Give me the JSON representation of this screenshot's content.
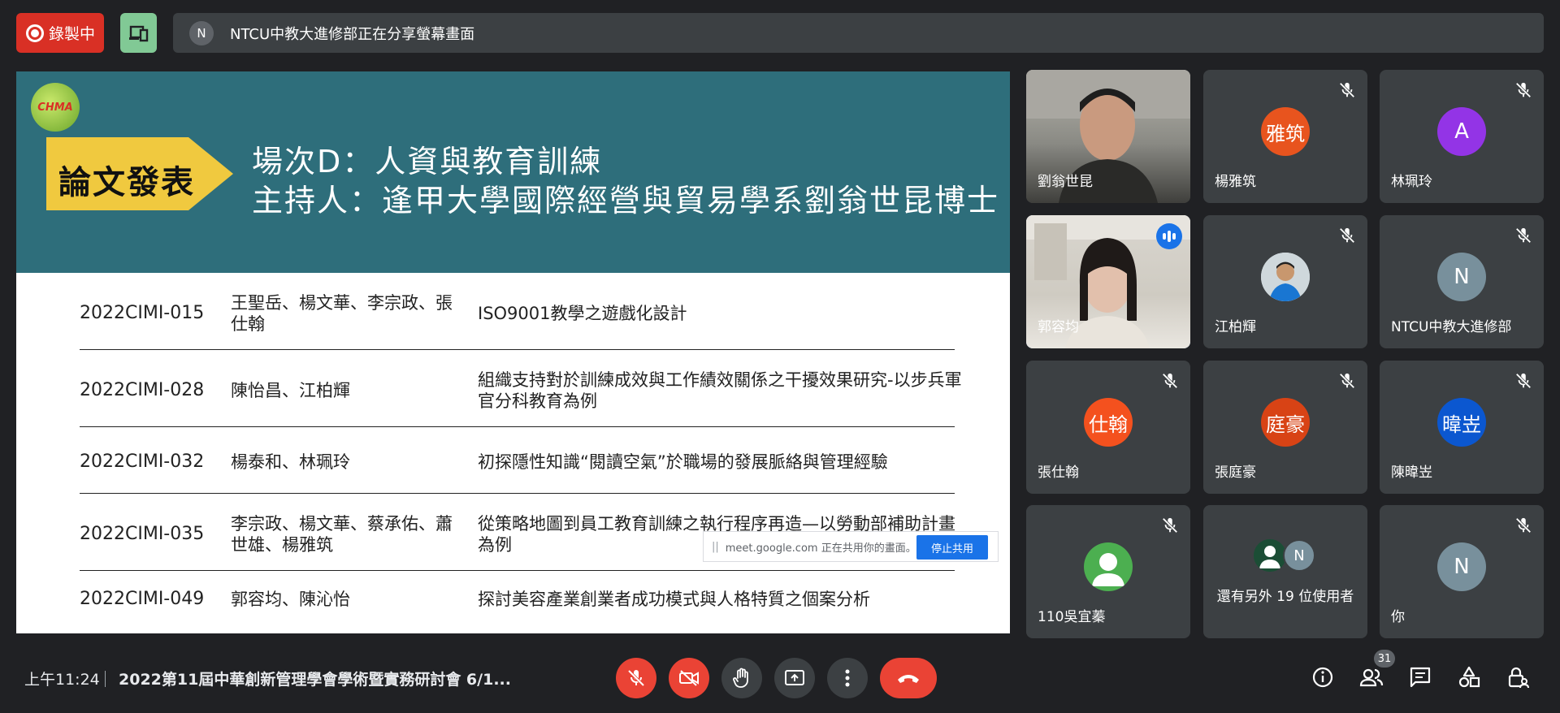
{
  "top_bar": {
    "recording_label": "錄製中",
    "share_avatar_letter": "N",
    "share_message": "NTCU中教大進修部正在分享螢幕畫面"
  },
  "slide": {
    "logo_text": "CHMA",
    "tag": "論文發表",
    "title_line1": "場次D：人資與教育訓練",
    "title_line2": "主持人：逢甲大學國際經營與貿易學系劉翁世昆博士",
    "papers": [
      {
        "id": "2022CIMI-015",
        "authors": "王聖岳、楊文華、李宗政、張仕翰",
        "title": "ISO9001教學之遊戲化設計"
      },
      {
        "id": "2022CIMI-028",
        "authors": "陳怡昌、江柏輝",
        "title": "組織支持對於訓練成效與工作績效關係之干擾效果研究-以步兵軍官分科教育為例"
      },
      {
        "id": "2022CIMI-032",
        "authors": "楊泰和、林珮玲",
        "title": "初探隱性知識“閱讀空氣”於職場的發展脈絡與管理經驗"
      },
      {
        "id": "2022CIMI-035",
        "authors": "李宗政、楊文華、蔡承佑、蕭世雄、楊雅筑",
        "title": "從策略地圖到員工教育訓練之執行程序再造—以勞動部補助計畫為例"
      },
      {
        "id": "2022CIMI-049",
        "authors": "郭容均、陳沁怡",
        "title": "探討美容產業創業者成功模式與人格特質之個案分析"
      }
    ],
    "share_notice_text": "meet.google.com 正在共用你的畫面。",
    "stop_share_label": "停止共用"
  },
  "participants": [
    {
      "name": "劉翁世昆",
      "type": "video"
    },
    {
      "name": "楊雅筑",
      "avatar": "雅筑",
      "color": "#e8541e"
    },
    {
      "name": "林珮玲",
      "avatar": "A",
      "color": "#9334e6"
    },
    {
      "name": "郭容均",
      "type": "video",
      "speaking": true
    },
    {
      "name": "江柏輝",
      "type": "photo"
    },
    {
      "name": "NTCU中教大進修部",
      "avatar": "N",
      "color": "#78909c"
    },
    {
      "name": "張仕翰",
      "avatar": "仕翰",
      "color": "#f4511e"
    },
    {
      "name": "張庭豪",
      "avatar": "庭豪",
      "color": "#d84315"
    },
    {
      "name": "陳暐岦",
      "avatar": "暐岦",
      "color": "#0b57d0"
    },
    {
      "name": "110吳宜蓁",
      "avatar": "",
      "color": "#4caf50"
    },
    {
      "name": "還有另外 19 位使用者",
      "type": "more",
      "more_letter": "N"
    },
    {
      "name": "你",
      "avatar": "N",
      "color": "#78909c"
    }
  ],
  "bottom_bar": {
    "time": "上午11:24",
    "meeting_title": "2022第11屆中華創新管理學會學術暨實務研討會 6/1...",
    "participant_count": "31"
  },
  "colors": {
    "background": "#202124",
    "tile": "#3c4043",
    "red": "#ea4335",
    "slide_header": "#2e6e7b",
    "tag_yellow": "#f0c93f"
  }
}
